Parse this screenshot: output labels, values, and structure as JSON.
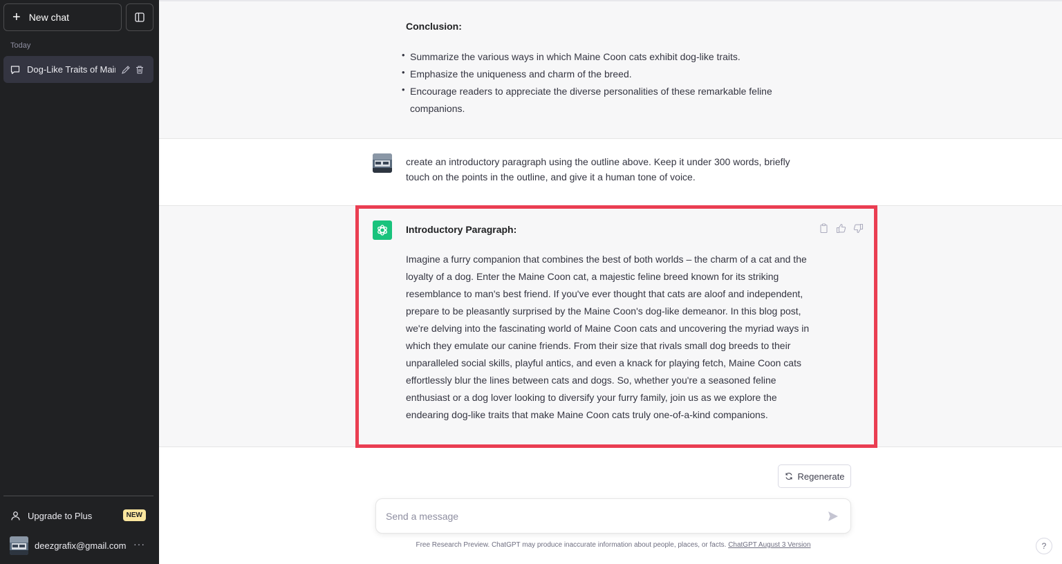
{
  "sidebar": {
    "new_chat_label": "New chat",
    "section_label": "Today",
    "history": [
      {
        "label": "Dog-Like Traits of Main"
      }
    ],
    "upgrade_label": "Upgrade to Plus",
    "upgrade_badge": "NEW",
    "account_email": "deezgrafix@gmail.com",
    "account_menu": "···"
  },
  "conversation": {
    "conclusion": {
      "heading": "Conclusion:",
      "bullets": [
        "Summarize the various ways in which Maine Coon cats exhibit dog-like traits.",
        "Emphasize the uniqueness and charm of the breed.",
        "Encourage readers to appreciate the diverse personalities of these remarkable feline companions."
      ]
    },
    "user_message": "create an introductory paragraph using the outline above. Keep it under 300 words, briefly touch on the points in the outline, and give it a human tone of voice.",
    "assistant_reply": {
      "heading": "Introductory Paragraph:",
      "body": "Imagine a furry companion that combines the best of both worlds – the charm of a cat and the loyalty of a dog. Enter the Maine Coon cat, a majestic feline breed known for its striking resemblance to man's best friend. If you've ever thought that cats are aloof and independent, prepare to be pleasantly surprised by the Maine Coon's dog-like demeanor. In this blog post, we're delving into the fascinating world of Maine Coon cats and uncovering the myriad ways in which they emulate our canine friends. From their size that rivals small dog breeds to their unparalleled social skills, playful antics, and even a knack for playing fetch, Maine Coon cats effortlessly blur the lines between cats and dogs. So, whether you're a seasoned feline enthusiast or a dog lover looking to diversify your furry family, join us as we explore the endearing dog-like traits that make Maine Coon cats truly one-of-a-kind companions."
    }
  },
  "composer": {
    "regenerate_label": "Regenerate",
    "placeholder": "Send a message",
    "disclaimer_text": "Free Research Preview. ChatGPT may produce inaccurate information about people, places, or facts. ",
    "disclaimer_link": "ChatGPT August 3 Version",
    "help_label": "?"
  },
  "colors": {
    "sidebar_bg": "#202123",
    "accent_green": "#19c37d",
    "highlight_red": "#ea3e52",
    "badge_yellow": "#fae69e"
  },
  "icons": [
    "plus-icon",
    "sidebar-toggle-icon",
    "chat-bubble-icon",
    "edit-icon",
    "trash-icon",
    "user-icon",
    "openai-logo-icon",
    "copy-icon",
    "thumbs-up-icon",
    "thumbs-down-icon",
    "refresh-icon",
    "send-icon"
  ]
}
